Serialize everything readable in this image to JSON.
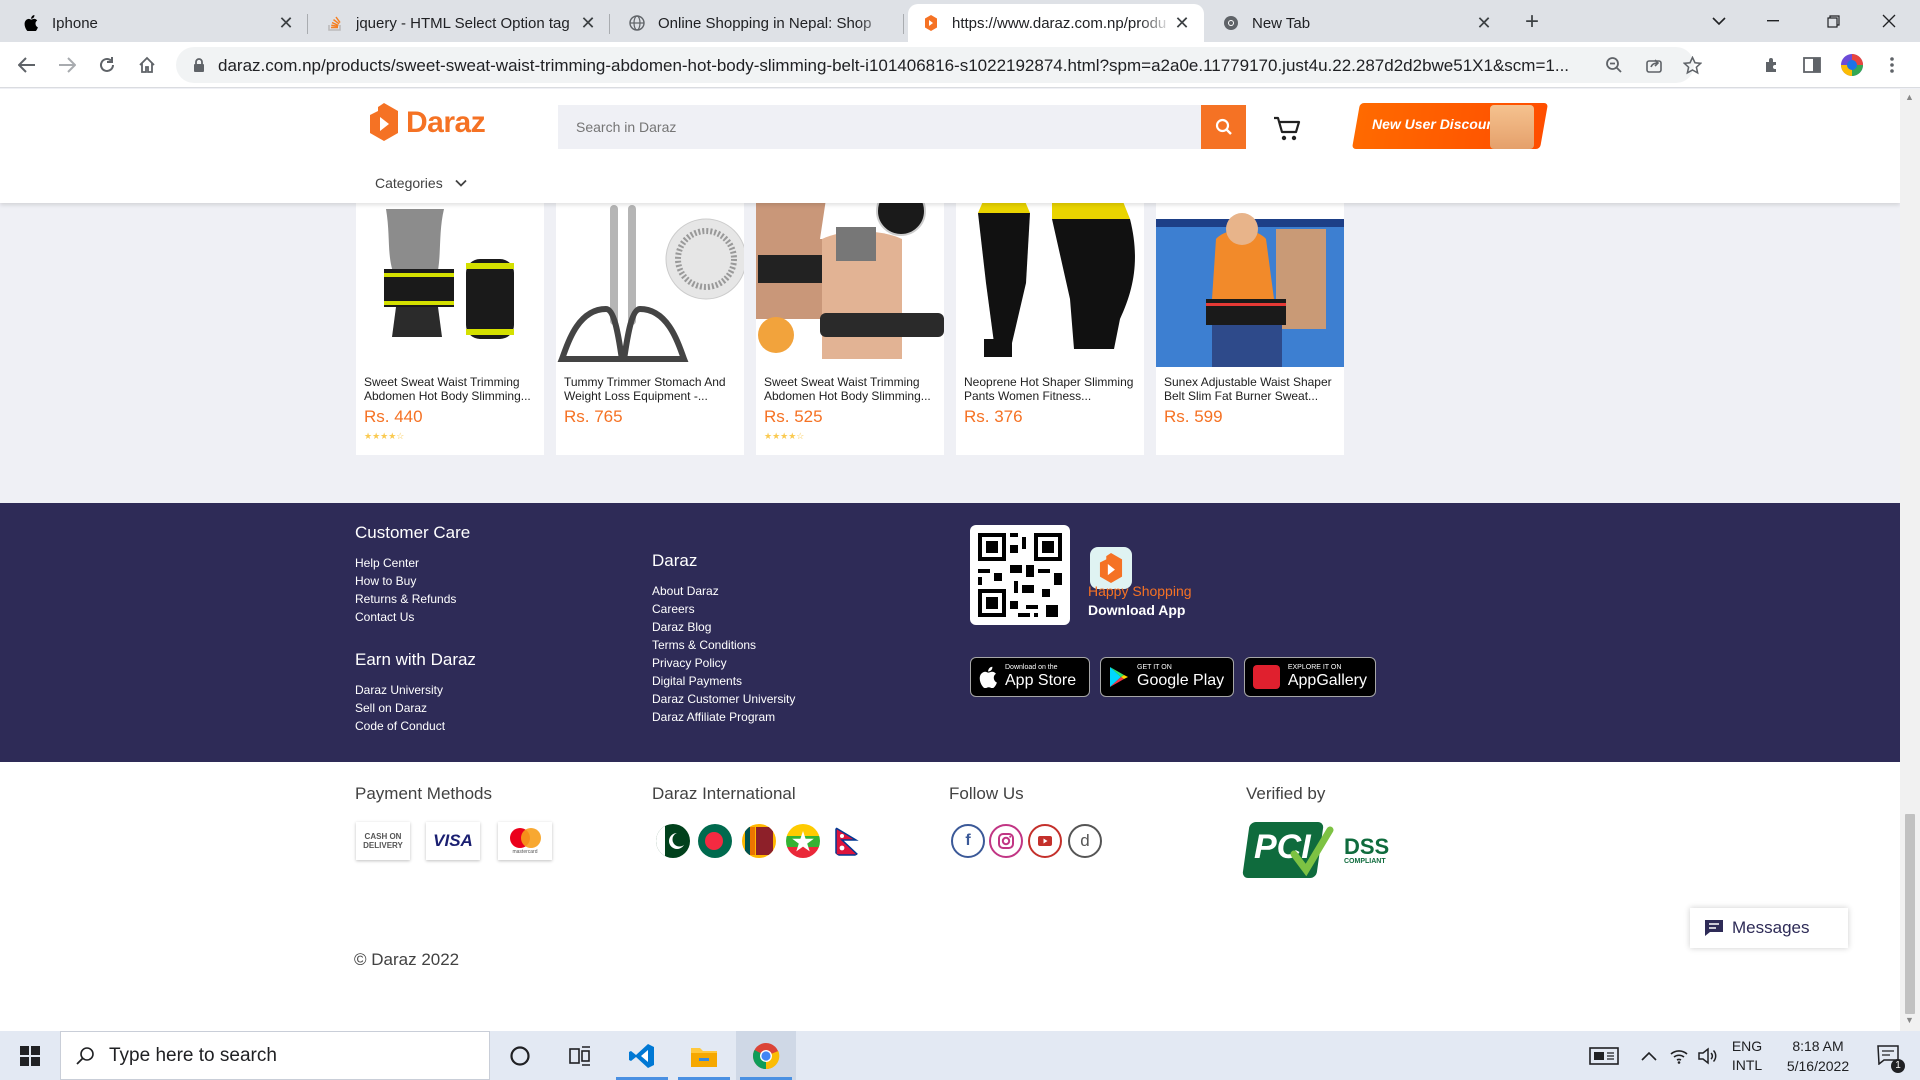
{
  "browser": {
    "tabs": [
      {
        "title": "Iphone",
        "icon": "apple-icon"
      },
      {
        "title": "jquery - HTML Select Option tag",
        "icon": "stackoverflow-icon"
      },
      {
        "title": "Online Shopping in Nepal: Shop",
        "icon": "globe-icon"
      },
      {
        "title": "https://www.daraz.com.np/produ",
        "icon": "daraz-icon"
      },
      {
        "title": "New Tab",
        "icon": "chrome-icon"
      }
    ],
    "url": "daraz.com.np/products/sweet-sweat-waist-trimming-abdomen-hot-body-slimming-belt-i101406816-s1022192874.html?spm=a2a0e.11779170.just4u.22.287d2d2bwe51X1&scm=1..."
  },
  "header": {
    "logo_text": "Daraz",
    "search_placeholder": "Search in Daraz",
    "promo_label": "New User Discount",
    "categories_label": "Categories"
  },
  "products": [
    {
      "name": "Sweet Sweat Waist Trimming Abdomen Hot Body Slimming...",
      "price": "Rs. 440",
      "rating": 4.5
    },
    {
      "name": "Tummy Trimmer Stomach And Weight Loss Equipment -...",
      "price": "Rs. 765"
    },
    {
      "name": "Sweet Sweat Waist Trimming Abdomen Hot Body Slimming...",
      "price": "Rs. 525",
      "rating": 4.5
    },
    {
      "name": "Neoprene Hot Shaper Slimming Pants Women Fitness...",
      "price": "Rs. 376"
    },
    {
      "name": "Sunex Adjustable Waist Shaper Belt Slim Fat Burner Sweat...",
      "price": "Rs. 599"
    }
  ],
  "footer": {
    "customer_care": {
      "title": "Customer Care",
      "links": [
        "Help Center",
        "How to Buy",
        "Returns & Refunds",
        "Contact Us"
      ]
    },
    "earn": {
      "title": "Earn with Daraz",
      "links": [
        "Daraz University",
        "Sell on Daraz",
        "Code of Conduct"
      ]
    },
    "daraz": {
      "title": "Daraz",
      "links": [
        "About Daraz",
        "Careers",
        "Daraz Blog",
        "Terms & Conditions",
        "Privacy Policy",
        "Digital Payments",
        "Daraz Customer University",
        "Daraz Affiliate Program"
      ]
    },
    "app": {
      "tagline": "Happy Shopping",
      "download": "Download App",
      "stores": [
        {
          "small": "Download on the",
          "large": "App Store"
        },
        {
          "small": "GET IT ON",
          "large": "Google Play"
        },
        {
          "small": "EXPLORE IT ON",
          "large": "AppGallery"
        }
      ]
    },
    "payment": {
      "title": "Payment Methods",
      "methods": [
        {
          "label_1": "CASH ON",
          "label_2": "DELIVERY"
        },
        {
          "label_1": "VISA"
        },
        {
          "label_1": "mastercard"
        }
      ]
    },
    "international": {
      "title": "Daraz International"
    },
    "follow": {
      "title": "Follow Us"
    },
    "verified": {
      "title": "Verified by",
      "badge": "PCI",
      "badge_2": "DSS",
      "badge_3": "COMPLIANT"
    },
    "copyright": "© Daraz 2022"
  },
  "chat": {
    "label": "Messages"
  },
  "taskbar": {
    "search_placeholder": "Type here to search",
    "lang_1": "ENG",
    "lang_2": "INTL",
    "time": "8:18 AM",
    "date": "5/16/2022",
    "notifications": "1"
  },
  "colors": {
    "brand": "#f57224",
    "footer_bg": "#2e2b57"
  }
}
